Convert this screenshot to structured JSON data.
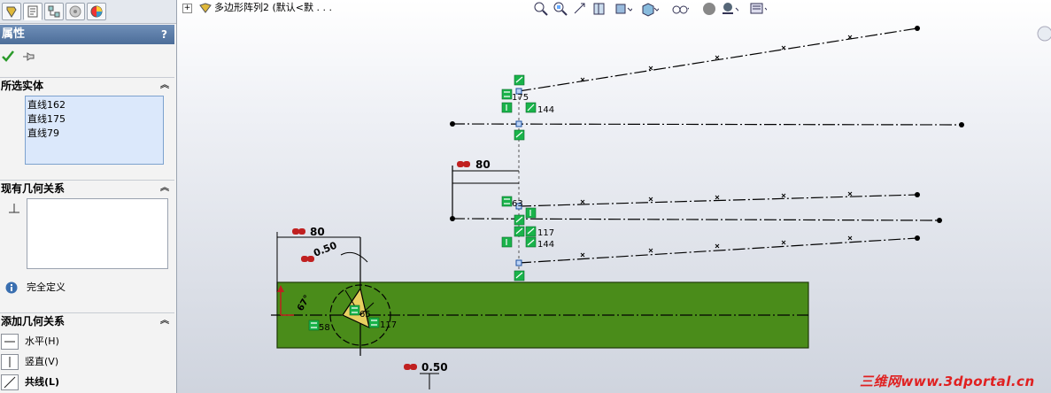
{
  "tabs": [
    {
      "icon": "feature-manager-icon"
    },
    {
      "icon": "property-manager-icon"
    },
    {
      "icon": "configuration-manager-icon"
    },
    {
      "icon": "dimxpert-icon"
    },
    {
      "icon": "display-manager-icon"
    }
  ],
  "property_manager": {
    "title": "属性",
    "help": "?",
    "ok_icon": "checkmark-icon",
    "pin_icon": "pushpin-icon",
    "selected_entities": {
      "header": "所选实体",
      "items": [
        "直线162",
        "直线175",
        "直线79"
      ]
    },
    "existing_relations": {
      "header": "现有几何关系",
      "items": []
    },
    "status": "完全定义",
    "add_relations": {
      "header": "添加几何关系",
      "items": [
        "水平(H)",
        "竖直(V)",
        "共线(L)"
      ]
    }
  },
  "graphics": {
    "tree_text": "多边形阵列2   (默认<默 . . .",
    "hud_icons": [
      "zoom-to-fit-icon",
      "zoom-to-area-icon",
      "previous-view-icon",
      "section-view-icon",
      "view-orientation-icon",
      "display-style-icon",
      "hide-show-items-icon",
      "edit-appearance-icon",
      "apply-scene-icon",
      "view-settings-icon"
    ],
    "watermark": "三维网www.3dportal.cn",
    "dimensions": {
      "d_top": "80",
      "d_left": "80",
      "d_dia": "0.50",
      "d_bottom": "0.50",
      "d_angle": "67°"
    },
    "relation_labels": {
      "r175": "175",
      "r144a": "144",
      "r63": "63",
      "r117a": "117",
      "r144b": "144",
      "r65": "65",
      "r117b": "117",
      "r58": "58"
    }
  }
}
